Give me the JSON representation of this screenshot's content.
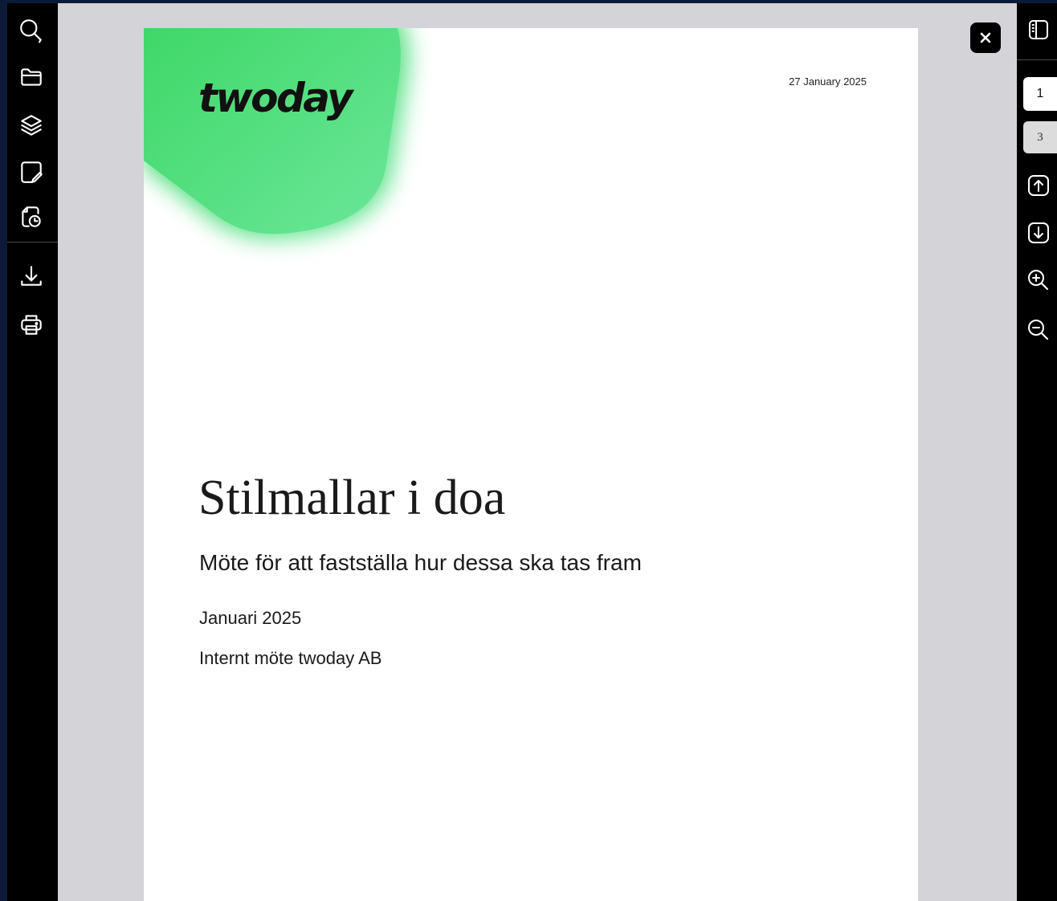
{
  "toolbar_left": {
    "icons": [
      "search-icon",
      "folder-icon",
      "layers-icon",
      "annotation-icon",
      "document-history-icon",
      "download-icon",
      "print-icon"
    ]
  },
  "document": {
    "logo": "twoday",
    "date": "27 January 2025",
    "title": "Stilmallar i doa",
    "subtitle": "Möte för att fastställa hur dessa ska tas fram",
    "line1": "Januari 2025",
    "line2": "Internt möte twoday AB",
    "brand_color": "#4cdd78"
  },
  "toolbar_right": {
    "current_page": "1",
    "total_pages": "3",
    "icons": [
      "sidebar-toggle-icon",
      "previous-page-icon",
      "next-page-icon",
      "zoom-in-icon",
      "zoom-out-icon"
    ]
  },
  "close_icon": "close-icon"
}
